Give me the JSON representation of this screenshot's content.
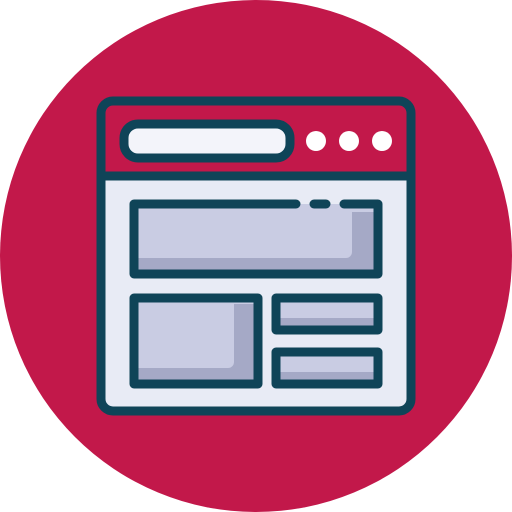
{
  "icon": {
    "name": "browser-window-layout-icon",
    "colors": {
      "background_circle": "#C2184A",
      "outline": "#0F4458",
      "title_bar": "#C2184A",
      "window_body": "#E8EBF5",
      "panel_fill": "#C9CCE3",
      "panel_shadow": "#A5A9C6",
      "address_bar": "#F3F4FA",
      "window_dots": "#FFFFFF"
    }
  }
}
